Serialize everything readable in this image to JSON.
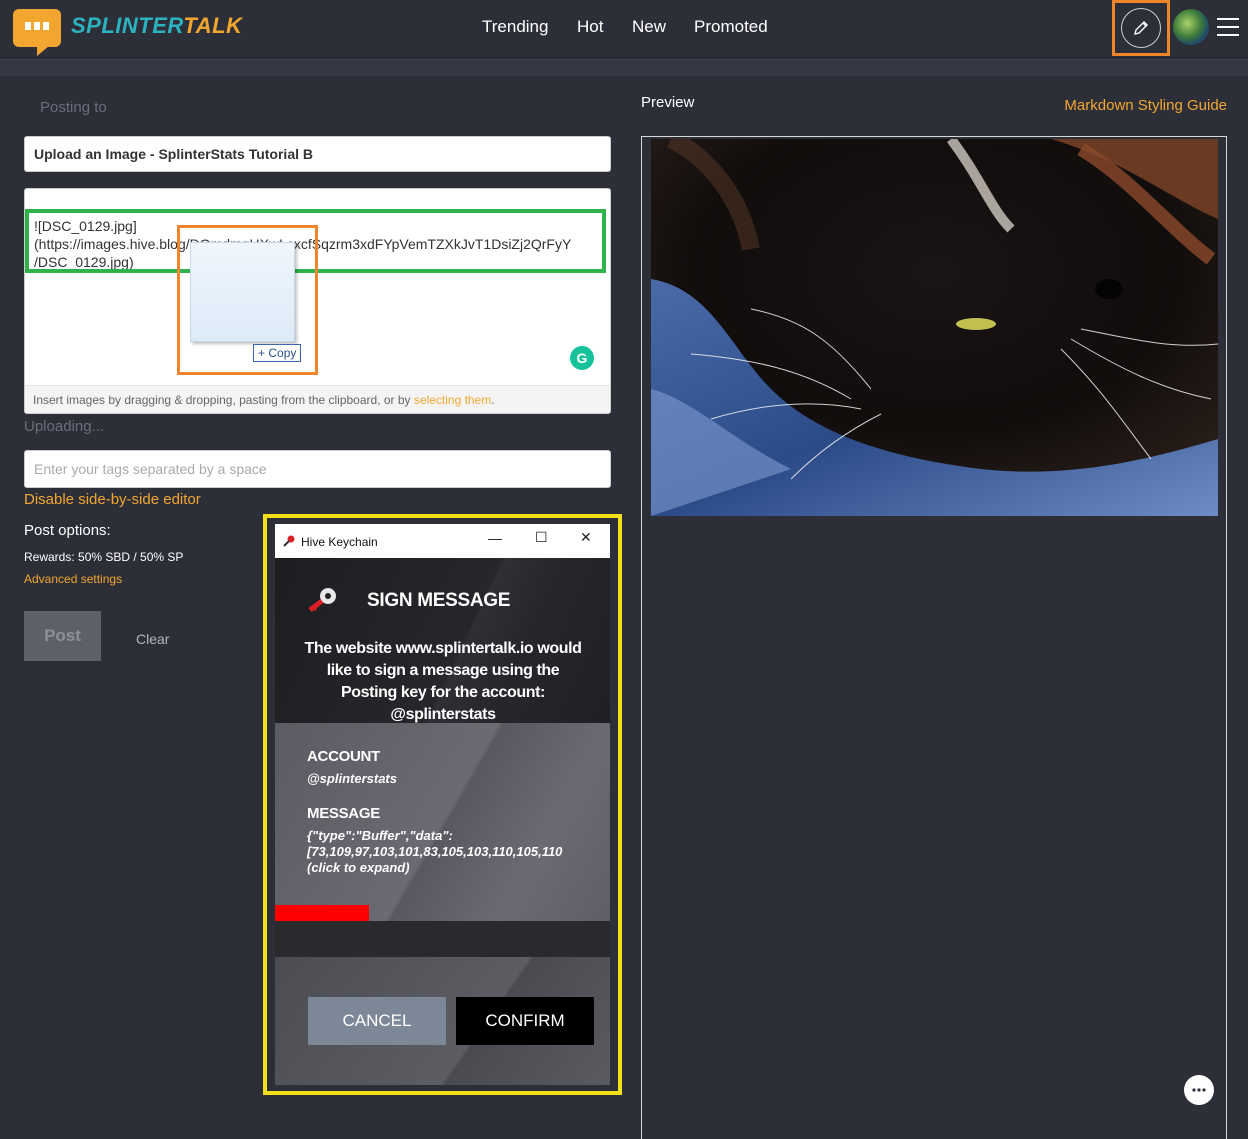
{
  "header": {
    "logo_part1": "SPLINTER",
    "logo_part2": "TALK",
    "nav": [
      "Trending",
      "Hot",
      "New",
      "Promoted"
    ]
  },
  "editor": {
    "posting_to": "Posting to",
    "title_value": "Upload an Image - SplinterStats Tutorial B",
    "body_lines": [
      "![DSC_0129.jpg]",
      "(https://images.hive.blog/DQmdmgHXwLcxcfSqzrm3xdFYpVemTZXkJvT1DsiZj2QrFyY",
      "/DSC_0129.jpg)"
    ],
    "copy_tooltip": "Copy",
    "grammarly_letter": "G",
    "footer_text": "Insert images by dragging & dropping, pasting from the clipboard, or by ",
    "footer_link": "selecting them",
    "footer_end": ".",
    "uploading": "Uploading...",
    "tags_placeholder": "Enter your tags separated by a space",
    "disable_side_by_side": "Disable side-by-side editor",
    "post_options": "Post options:",
    "rewards": "Rewards: 50% SBD / 50% SP",
    "advanced_settings": "Advanced settings",
    "post_button": "Post",
    "clear_button": "Clear"
  },
  "preview": {
    "label": "Preview",
    "markdown_guide": "Markdown Styling Guide"
  },
  "keychain": {
    "window_title": "Hive Keychain",
    "heading": "SIGN MESSAGE",
    "description": "The website www.splintertalk.io would like to sign a message using the Posting key for the account: @splinterstats",
    "account_label": "ACCOUNT",
    "account_value": "@splinterstats",
    "message_label": "MESSAGE",
    "message_line1": "{\"type\":\"Buffer\",\"data\":",
    "message_line2": "[73,109,97,103,101,83,105,103,110,105,110",
    "message_line3": "(click to expand)",
    "cancel": "CANCEL",
    "confirm": "CONFIRM"
  },
  "colors": {
    "accent_orange": "#f2a630",
    "accent_teal": "#2bb3c0",
    "highlight_orange": "#f0862c",
    "highlight_green": "#2db34a",
    "highlight_yellow": "#f3e01a"
  }
}
